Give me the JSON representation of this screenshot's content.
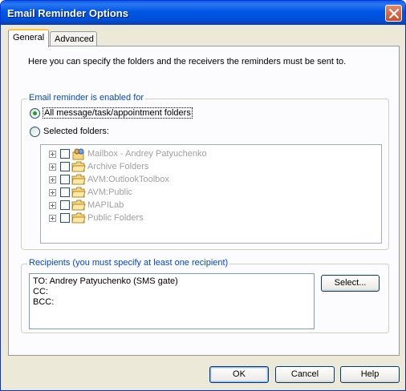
{
  "window": {
    "title": "Email Reminder Options"
  },
  "tabs": [
    {
      "label": "General",
      "active": true
    },
    {
      "label": "Advanced",
      "active": false
    }
  ],
  "general": {
    "intro": "Here you can specify the folders and the receivers the reminders must be sent to.",
    "enabled_group": {
      "label": "Email reminder is enabled for",
      "options": [
        {
          "label": "All message/task/appointment folders",
          "selected": true
        },
        {
          "label": "Selected folders:",
          "selected": false
        }
      ]
    },
    "folders": [
      {
        "label": "Mailbox - Andrey Patyuchenko",
        "icon": "mailbox-icon",
        "checked": false
      },
      {
        "label": "Archive Folders",
        "icon": "folder-icon",
        "checked": false
      },
      {
        "label": "AVM:OutlookToolbox",
        "icon": "folder-icon",
        "checked": false
      },
      {
        "label": "AVM:Public",
        "icon": "folder-icon",
        "checked": false
      },
      {
        "label": "MAPILab",
        "icon": "folder-icon",
        "checked": false
      },
      {
        "label": "Public Folders",
        "icon": "folder-icon",
        "checked": false
      }
    ],
    "recipients_group": {
      "label": "Recipients (you must specify at least one recipient)",
      "to": "TO: Andrey Patyuchenko (SMS gate)",
      "cc": "CC:",
      "bcc": "BCC:",
      "select_button": "Select..."
    }
  },
  "footer": {
    "ok": "OK",
    "cancel": "Cancel",
    "help": "Help"
  },
  "colors": {
    "titlebar": "#0055e5",
    "group_label": "#0046d5",
    "dialog_bg": "#ece9d8",
    "radio_selected": "#21a121"
  }
}
